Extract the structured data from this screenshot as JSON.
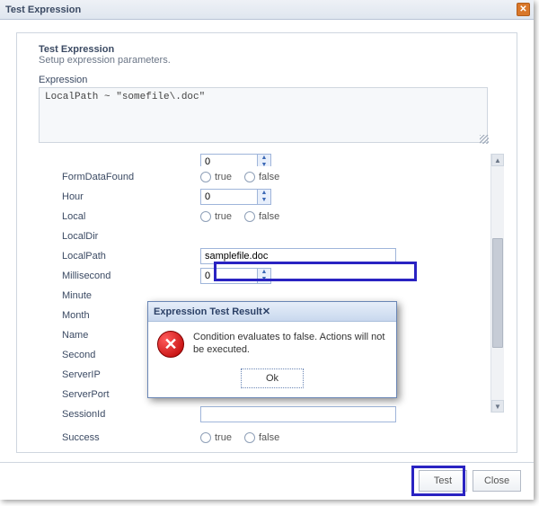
{
  "window": {
    "title": "Test Expression"
  },
  "panel": {
    "title": "Test Expression",
    "subtitle": "Setup expression parameters."
  },
  "expression": {
    "label": "Expression",
    "value": "LocalPath ~ \"somefile\\.doc\""
  },
  "fields": {
    "partialTop": {
      "label": "",
      "value": "0"
    },
    "formDataFound": {
      "label": "FormDataFound",
      "true_label": "true",
      "false_label": "false"
    },
    "hour": {
      "label": "Hour",
      "value": "0"
    },
    "local": {
      "label": "Local",
      "true_label": "true",
      "false_label": "false"
    },
    "localDir": {
      "label": "LocalDir",
      "value": ""
    },
    "localPath": {
      "label": "LocalPath",
      "value": "samplefile.doc"
    },
    "millisecond": {
      "label": "Millisecond",
      "value": "0"
    },
    "minute": {
      "label": "Minute",
      "value": ""
    },
    "month": {
      "label": "Month",
      "value": ""
    },
    "name": {
      "label": "Name",
      "value": ""
    },
    "second": {
      "label": "Second",
      "value": ""
    },
    "serverIP": {
      "label": "ServerIP",
      "value": ""
    },
    "serverPort": {
      "label": "ServerPort",
      "value": ""
    },
    "sessionId": {
      "label": "SessionId",
      "value": ""
    },
    "success": {
      "label": "Success",
      "true_label": "true",
      "false_label": "false"
    }
  },
  "footer": {
    "test": "Test",
    "close": "Close"
  },
  "modal": {
    "title": "Expression Test Result",
    "message": "Condition evaluates to false. Actions will not be executed.",
    "ok": "Ok"
  }
}
